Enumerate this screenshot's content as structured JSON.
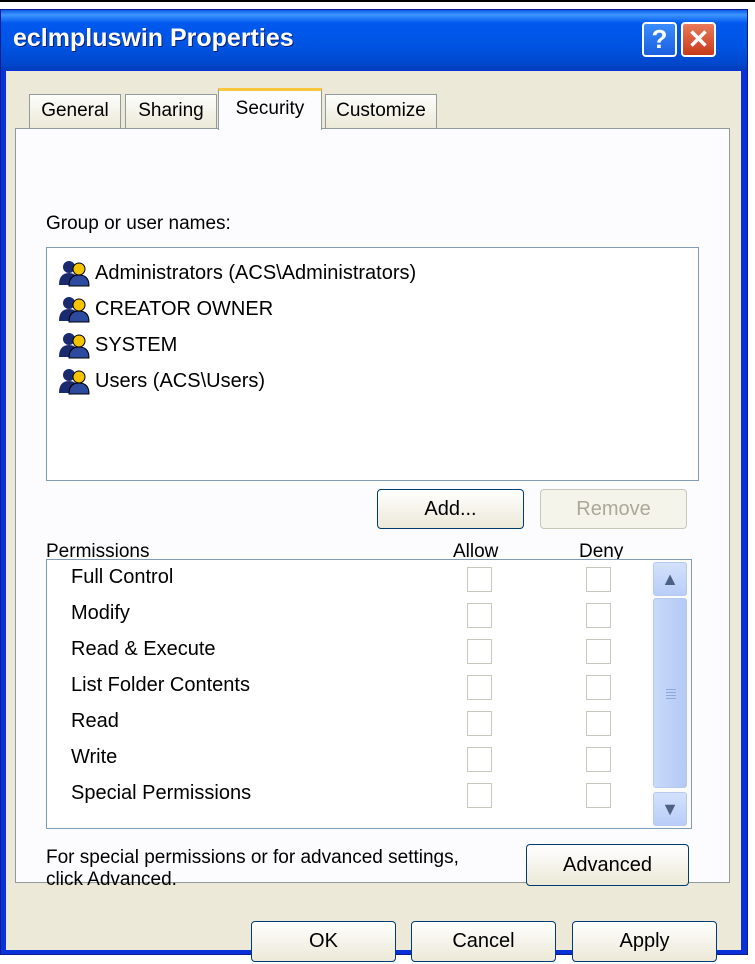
{
  "window": {
    "title": "eclmpluswin Properties",
    "help_label": "?",
    "close_label": "✕"
  },
  "tabs": [
    {
      "label": "General",
      "active": false
    },
    {
      "label": "Sharing",
      "active": false
    },
    {
      "label": "Security",
      "active": true
    },
    {
      "label": "Customize",
      "active": false
    }
  ],
  "security": {
    "group_label": "Group or user names:",
    "users": [
      {
        "name": "Administrators (ACS\\Administrators)",
        "icon": "users-icon"
      },
      {
        "name": "CREATOR OWNER",
        "icon": "users-icon"
      },
      {
        "name": "SYSTEM",
        "icon": "users-icon"
      },
      {
        "name": "Users (ACS\\Users)",
        "icon": "users-icon"
      }
    ],
    "add_label": "Add...",
    "remove_label": "Remove",
    "permissions_header": "Permissions",
    "allow_header": "Allow",
    "deny_header": "Deny",
    "permissions": [
      {
        "name": "Full Control",
        "allow": false,
        "deny": false
      },
      {
        "name": "Modify",
        "allow": false,
        "deny": false
      },
      {
        "name": "Read & Execute",
        "allow": false,
        "deny": false
      },
      {
        "name": "List Folder Contents",
        "allow": false,
        "deny": false
      },
      {
        "name": "Read",
        "allow": false,
        "deny": false
      },
      {
        "name": "Write",
        "allow": false,
        "deny": false
      },
      {
        "name": "Special Permissions",
        "allow": false,
        "deny": false
      }
    ],
    "advanced_text_line1": "For special permissions or for advanced settings,",
    "advanced_text_line2": "click Advanced.",
    "advanced_label": "Advanced"
  },
  "footer": {
    "ok_label": "OK",
    "cancel_label": "Cancel",
    "apply_label": "Apply"
  },
  "colors": {
    "titlebar": "#0054e3",
    "dialog_bg": "#ece9d8",
    "active_tab_accent": "#ffc83c"
  }
}
